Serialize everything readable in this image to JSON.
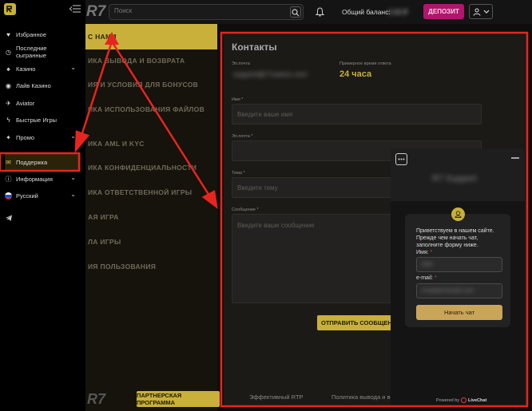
{
  "topbar": {
    "logo": "R7",
    "search_placeholder": "Поиск",
    "balance_label": "Общий баланс:",
    "balance_value": "0.00 ₽",
    "deposit_label": "ДЕПОЗИТ",
    "colors": {
      "deposit": "#b0166e",
      "accent": "#c9b03a"
    }
  },
  "sidebar": {
    "items": [
      {
        "label": "Избранное",
        "icon": "heart-icon"
      },
      {
        "label": "Последние сыгранные",
        "icon": "clock-icon"
      },
      {
        "label": "Казино",
        "icon": "spade-icon"
      },
      {
        "label": "Лайв Казино",
        "icon": "chip-icon"
      },
      {
        "label": "Aviator",
        "icon": "plane-icon"
      },
      {
        "label": "Быстрые Игры",
        "icon": "bolt-icon"
      },
      {
        "label": "Промо",
        "icon": "gift-icon"
      },
      {
        "label": "Поддержка",
        "icon": "support-icon"
      },
      {
        "label": "Информация",
        "icon": "info-icon"
      },
      {
        "label": "Русский",
        "icon": "flag-ru-icon"
      }
    ]
  },
  "policy": {
    "items": [
      "С НАМИ",
      "ИКА ВЫВОДА И ВОЗВРАТА",
      "ИЯ И УСЛОВИЯ ДЛЯ БОНУСОВ",
      "ИКА ИСПОЛЬЗОВАНИЯ ФАЙЛОВ",
      "ИКА AML И KYC",
      "ИКА КОНФИДЕНЦИАЛЬНОСТИ",
      "ИКА ОТВЕТСТВЕННОЙ ИГРЫ",
      "АЯ ИГРА",
      "ЛА ИГРЫ",
      "ИЯ ПОЛЬЗОВАНИЯ"
    ],
    "footer_logo": "R7",
    "partner_button": "ПАРТНЕРСКАЯ ПРОГРАММА"
  },
  "contacts": {
    "title": "Контакты",
    "email_label": "Эл.почта",
    "email_value": "support@r7casino.com",
    "response_label": "Примерное время ответа",
    "response_value": "24 часа",
    "name_label": "Имя *",
    "name_placeholder": "Введите ваше имя",
    "email_field_label": "Эл.почта *",
    "subject_label": "Тема *",
    "subject_placeholder": "Введите тему",
    "message_label": "Сообщение *",
    "message_placeholder": "Введите ваше сообщение",
    "send_button": "ОТПРАВИТЬ СООБЩЕНИЕ",
    "footer_links": [
      "Эффективный RTP",
      "Политика вывода и воз"
    ]
  },
  "chat": {
    "greeting": "Приветствуем в нашем сайте. Прежде чем начать чат, заполните форму ниже.",
    "name_label": "Имя:",
    "email_label": "e-mail:",
    "start_button": "Начать чат",
    "powered_by": "Powered by",
    "brand": "LiveChat",
    "header_blur": "R7 Support",
    "name_blur": "Имя",
    "email_blur": "email@example.com"
  }
}
